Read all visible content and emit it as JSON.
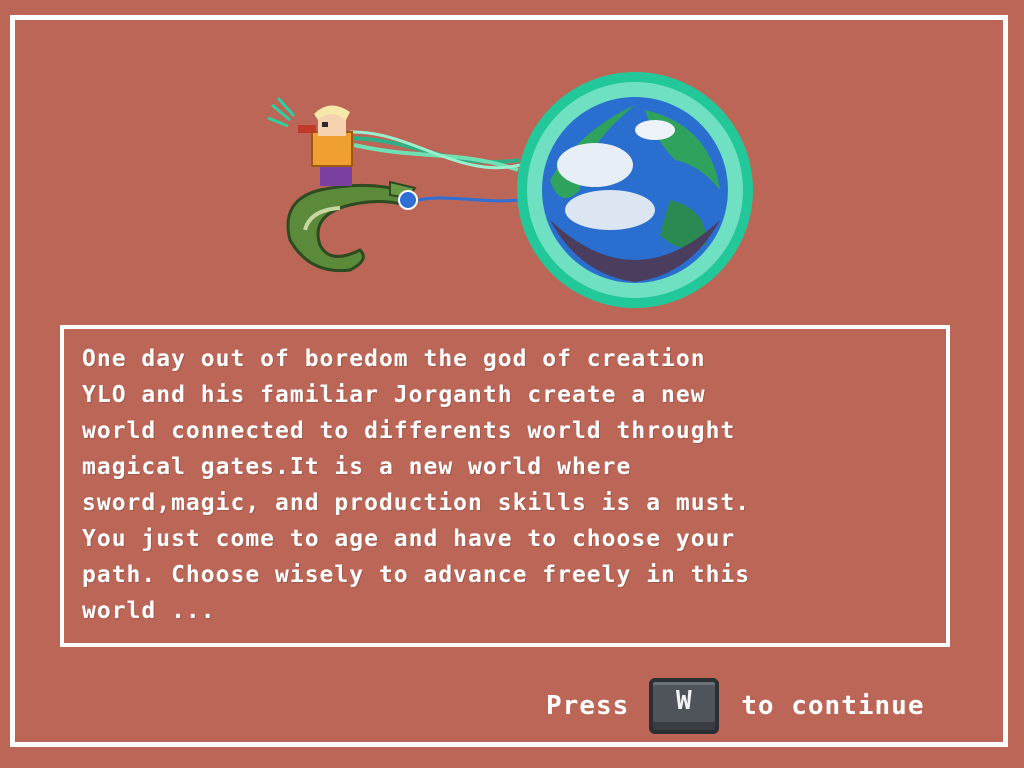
{
  "story": {
    "lines": [
      "One day out of boredom the god of creation",
      "YLO and his familiar Jorganth create a new",
      "world connected to differents world throught",
      "magical gates.It is a new world where",
      "sword,magic, and production skills is a must.",
      "You just come to age and have to choose your",
      "path. Choose wisely to advance freely in this",
      "world ..."
    ]
  },
  "prompt": {
    "before": "Press",
    "key": "W",
    "after": "to continue"
  },
  "illustration": {
    "icons": [
      "god-on-dragon-sprite",
      "planet-globe-icon"
    ]
  },
  "colors": {
    "background": "#bb6657",
    "frame": "#ffffff",
    "glow": "#62dcb0",
    "tether": "#2f6fd6"
  }
}
